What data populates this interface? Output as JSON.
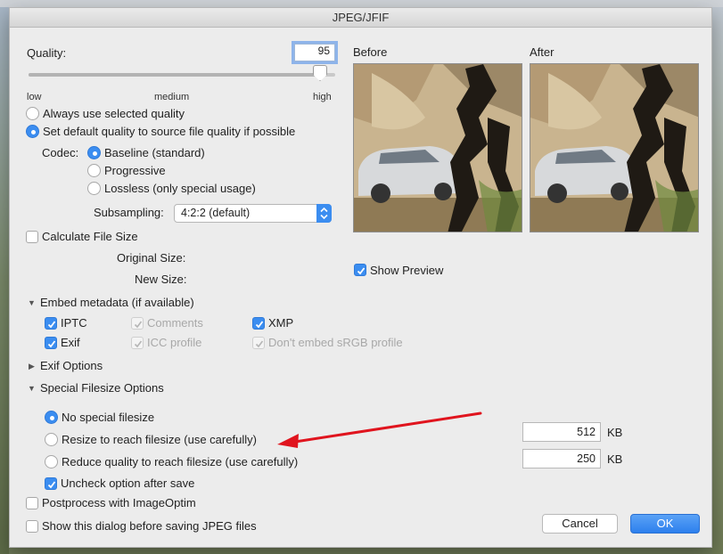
{
  "window": {
    "title": "JPEG/JFIF"
  },
  "quality": {
    "label": "Quality:",
    "value": "95",
    "slider_level": 0.95,
    "tick_low": "low",
    "tick_medium": "medium",
    "tick_high": "high"
  },
  "quality_mode": {
    "options": [
      {
        "label": "Always use selected quality",
        "selected": false
      },
      {
        "label": "Set default quality to source file quality if possible",
        "selected": true
      }
    ]
  },
  "codec": {
    "label": "Codec:",
    "options": [
      {
        "label": "Baseline (standard)",
        "selected": true
      },
      {
        "label": "Progressive",
        "selected": false
      },
      {
        "label": "Lossless (only special usage)",
        "selected": false
      }
    ]
  },
  "subsampling": {
    "label": "Subsampling:",
    "value": "4:2:2 (default)"
  },
  "file_size": {
    "calculate_label": "Calculate File Size",
    "original_label": "Original Size:",
    "new_label": "New Size:"
  },
  "preview": {
    "before_label": "Before",
    "after_label": "After",
    "show_preview_label": "Show Preview",
    "show_preview_checked": true
  },
  "metadata": {
    "header": "Embed metadata (if available)",
    "items": {
      "iptc": "IPTC",
      "comments": "Comments",
      "xmp": "XMP",
      "exif": "Exif",
      "icc": "ICC profile",
      "srgb": "Don't embed sRGB profile"
    }
  },
  "exif_options": {
    "header": "Exif Options"
  },
  "filesize": {
    "header": "Special Filesize Options",
    "no_special": "No special filesize",
    "resize": "Resize to reach filesize (use carefully)",
    "reduce": "Reduce quality to reach filesize (use carefully)",
    "uncheck": "Uncheck option after save",
    "resize_value": "512",
    "reduce_value": "250",
    "unit": "KB"
  },
  "postprocess_label": "Postprocess with ImageOptim",
  "show_dialog_label": "Show this dialog before saving JPEG files",
  "buttons": {
    "cancel": "Cancel",
    "ok": "OK"
  },
  "colors": {
    "accent": "#3b8df0",
    "arrow": "#e0141e"
  }
}
